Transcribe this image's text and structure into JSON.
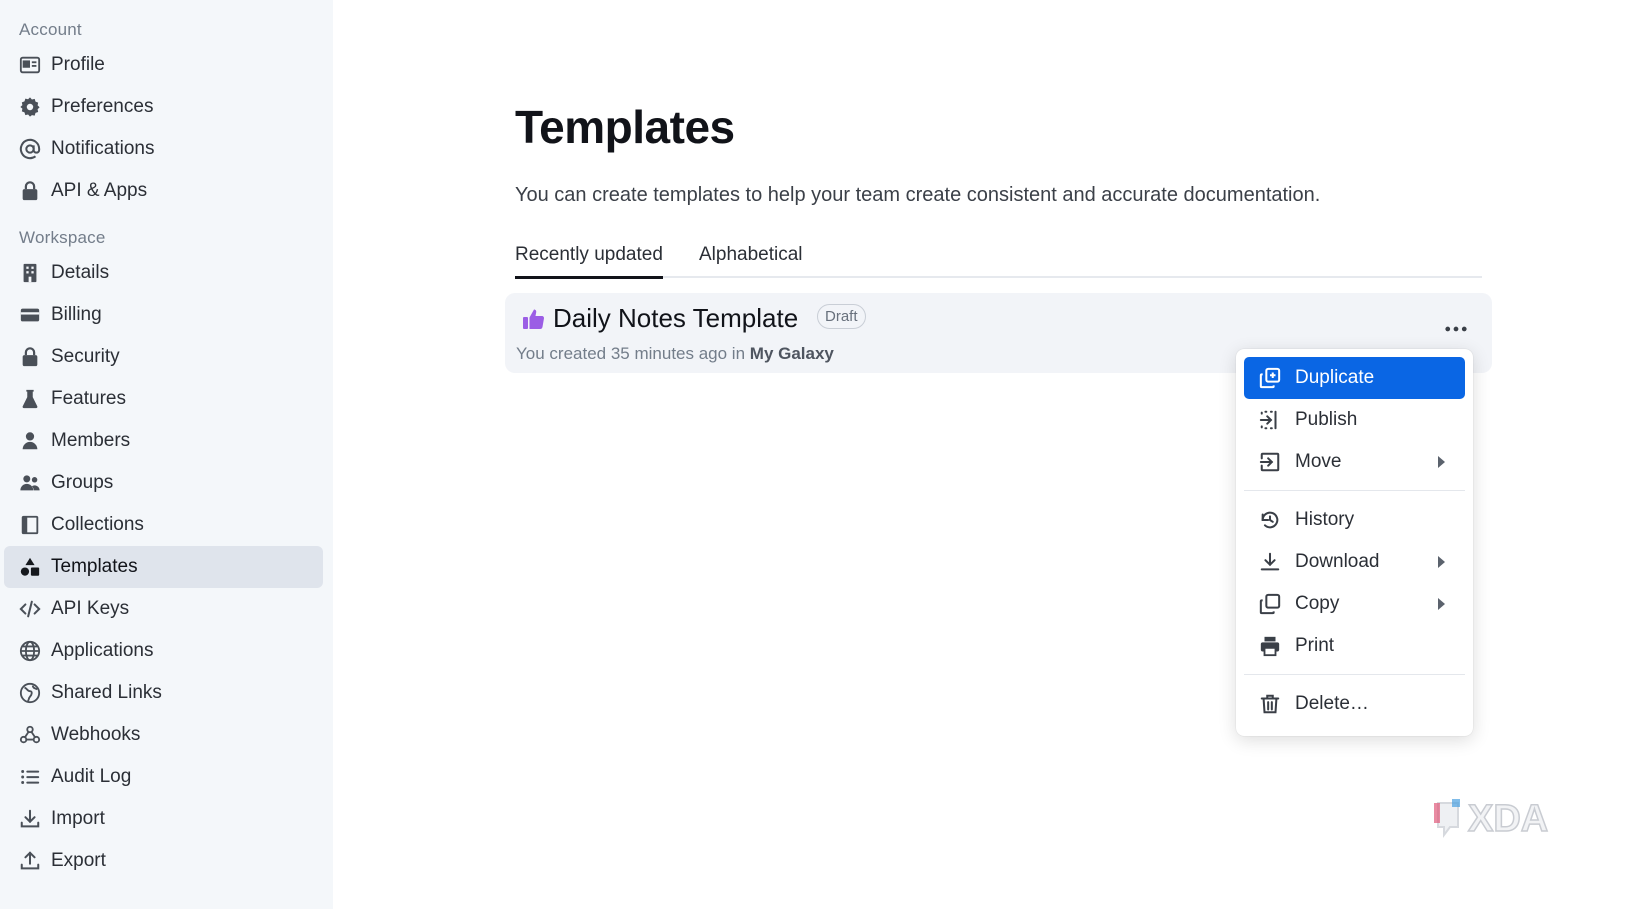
{
  "sidebar": {
    "sections": [
      {
        "title": "Account",
        "items": [
          {
            "label": "Profile",
            "icon": "profile-card-icon"
          },
          {
            "label": "Preferences",
            "icon": "gear-icon"
          },
          {
            "label": "Notifications",
            "icon": "at-sign-icon"
          },
          {
            "label": "API & Apps",
            "icon": "lock-icon"
          }
        ]
      },
      {
        "title": "Workspace",
        "items": [
          {
            "label": "Details",
            "icon": "building-icon"
          },
          {
            "label": "Billing",
            "icon": "credit-card-icon"
          },
          {
            "label": "Security",
            "icon": "lock-icon"
          },
          {
            "label": "Features",
            "icon": "beaker-icon"
          },
          {
            "label": "Members",
            "icon": "user-icon"
          },
          {
            "label": "Groups",
            "icon": "group-icon"
          },
          {
            "label": "Collections",
            "icon": "collection-icon"
          },
          {
            "label": "Templates",
            "icon": "shapes-icon",
            "active": true
          },
          {
            "label": "API Keys",
            "icon": "code-icon"
          },
          {
            "label": "Applications",
            "icon": "globe-icon"
          },
          {
            "label": "Shared Links",
            "icon": "globe-link-icon"
          },
          {
            "label": "Webhooks",
            "icon": "webhook-icon"
          },
          {
            "label": "Audit Log",
            "icon": "list-icon"
          },
          {
            "label": "Import",
            "icon": "download-icon"
          },
          {
            "label": "Export",
            "icon": "upload-icon"
          }
        ]
      }
    ]
  },
  "main": {
    "title": "Templates",
    "description": "You can create templates to help your team create consistent and accurate documentation.",
    "tabs": [
      {
        "label": "Recently updated",
        "active": true
      },
      {
        "label": "Alphabetical",
        "active": false
      }
    ],
    "template": {
      "emoji_icon": "thumbs-up-icon",
      "title": "Daily Notes Template",
      "badge": "Draft",
      "meta_prefix": "You created 35 minutes ago in",
      "collection": "My Galaxy"
    }
  },
  "menu": {
    "items": [
      {
        "label": "Duplicate",
        "icon": "duplicate-icon",
        "active": true,
        "submenu": false
      },
      {
        "label": "Publish",
        "icon": "publish-icon",
        "active": false,
        "submenu": false
      },
      {
        "label": "Move",
        "icon": "move-icon",
        "active": false,
        "submenu": true
      },
      {
        "label": "History",
        "icon": "history-icon",
        "active": false,
        "submenu": false
      },
      {
        "label": "Download",
        "icon": "download-icon",
        "active": false,
        "submenu": true
      },
      {
        "label": "Copy",
        "icon": "copy-icon",
        "active": false,
        "submenu": true
      },
      {
        "label": "Print",
        "icon": "printer-icon",
        "active": false,
        "submenu": false
      },
      {
        "label": "Delete…",
        "icon": "trash-icon",
        "active": false,
        "submenu": false
      }
    ]
  },
  "watermark": {
    "text": "XDA",
    "icon": "xda-logo-icon"
  },
  "colors": {
    "accent": "#0a66e4",
    "sidebar_bg": "#f4f7fa",
    "active_nav": "#dfe4ec",
    "emoji": "#9b5de5"
  }
}
